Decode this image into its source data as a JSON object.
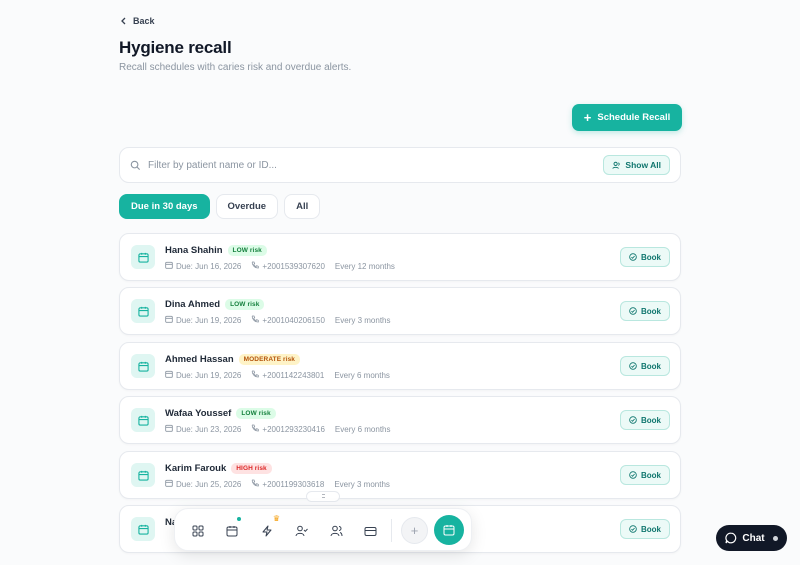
{
  "nav": {
    "back_label": "Back"
  },
  "header": {
    "title": "Hygiene recall",
    "subtitle": "Recall schedules with caries risk and overdue alerts."
  },
  "actions": {
    "schedule_label": "Schedule Recall"
  },
  "search": {
    "placeholder": "Filter by patient name or ID...",
    "show_all_label": "Show All"
  },
  "tabs": [
    {
      "label": "Due in 30 days",
      "active": true
    },
    {
      "label": "Overdue",
      "active": false
    },
    {
      "label": "All",
      "active": false
    }
  ],
  "patients": [
    {
      "name": "Hana Shahin",
      "risk": "LOW risk",
      "risk_level": "low",
      "due": "Due: Jun 16, 2026",
      "phone": "+2001539307620",
      "interval": "Every 12 months",
      "action": "Book"
    },
    {
      "name": "Dina Ahmed",
      "risk": "LOW risk",
      "risk_level": "low",
      "due": "Due: Jun 19, 2026",
      "phone": "+2001040206150",
      "interval": "Every 3 months",
      "action": "Book"
    },
    {
      "name": "Ahmed Hassan",
      "risk": "MODERATE risk",
      "risk_level": "moderate",
      "due": "Due: Jun 19, 2026",
      "phone": "+2001142243801",
      "interval": "Every 6 months",
      "action": "Book"
    },
    {
      "name": "Wafaa Youssef",
      "risk": "LOW risk",
      "risk_level": "low",
      "due": "Due: Jun 23, 2026",
      "phone": "+2001293230416",
      "interval": "Every 6 months",
      "action": "Book"
    },
    {
      "name": "Karim Farouk",
      "risk": "HIGH risk",
      "risk_level": "high",
      "due": "Due: Jun 25, 2026",
      "phone": "+2001199303618",
      "interval": "Every 3 months",
      "action": "Book"
    },
    {
      "name": "Na",
      "risk": "",
      "risk_level": "",
      "due": "",
      "phone": "",
      "interval": "",
      "action": "Book"
    }
  ],
  "dock": {
    "items": [
      "grid-icon",
      "calendar-icon",
      "bolt-icon",
      "user-check-icon",
      "users-icon",
      "card-icon",
      "plus-icon",
      "calendar-active-icon"
    ],
    "handle": ":::"
  },
  "chat": {
    "label": "Chat"
  },
  "colors": {
    "accent": "#17b3a0",
    "low": "#15803d",
    "moderate": "#b45309",
    "high": "#dc2626"
  }
}
